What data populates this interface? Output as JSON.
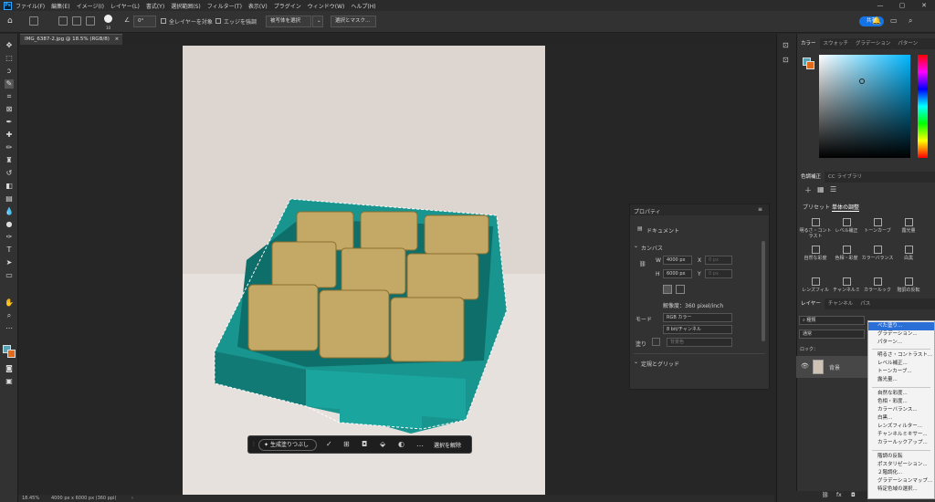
{
  "app": {
    "logo": "Ps"
  },
  "menu": [
    "ファイル(F)",
    "編集(E)",
    "イメージ(I)",
    "レイヤー(L)",
    "書式(Y)",
    "選択範囲(S)",
    "フィルター(T)",
    "表示(V)",
    "プラグイン",
    "ウィンドウ(W)",
    "ヘルプ(H)"
  ],
  "options": {
    "size": "10",
    "angle": "0°",
    "sample_all": "全レイヤーを対象",
    "enhance_edge": "エッジを強調",
    "select_subject": "被写体を選択",
    "select_mask": "選択とマスク...",
    "share": "共有"
  },
  "document_tab": {
    "label": "IMG_6387-2.jpg @ 18.5% (RGB/8)",
    "close": "×"
  },
  "status": {
    "zoom": "18.45%",
    "info": "4000 px x 6000 px (360 ppi)"
  },
  "taskbar": {
    "generative_fill": "生成塗りつぶし",
    "more": "…",
    "deselect": "選択を解除"
  },
  "color_panel": {
    "tabs": [
      "カラー",
      "スウォッチ",
      "グラデーション",
      "パターン"
    ],
    "accent": "#1473e6"
  },
  "adjust_panel": {
    "tabs": [
      "色調補正",
      "CC ライブラリ"
    ],
    "subtabs": [
      "プリセット",
      "単体の調整"
    ],
    "items": [
      "明るさ・コントラスト",
      "レベル補正",
      "トーンカーブ",
      "露光量",
      "自然な彩度",
      "色相・彩度",
      "カラーバランス",
      "白黒",
      "レンズフィル",
      "チャンネルミ",
      "カラールック",
      "階調の反転"
    ]
  },
  "layers_panel": {
    "tabs": [
      "レイヤー",
      "チャンネル",
      "パス"
    ],
    "search": "種類",
    "mode": "通常",
    "lock": "ロック：",
    "layer_name": "背景"
  },
  "properties": {
    "title": "プロパティ",
    "doc": "ドキュメント",
    "canvas": "カンバス",
    "w_label": "W",
    "w": "4000 px",
    "x_label": "X",
    "x": "0 px",
    "h_label": "H",
    "h": "6000 px",
    "y_label": "Y",
    "y": "0 px",
    "resolution": "解像度：360 pixel/inch",
    "mode_label": "モード",
    "mode": "RGB カラー",
    "bits": "8 bit/チャンネル",
    "fill_label": "塗り",
    "fill": "背景色",
    "guides": "定規とグリッド"
  },
  "dropdown": {
    "groups": [
      [
        "べた塗り...",
        "グラデーション...",
        "パターン..."
      ],
      [
        "明るさ・コントラスト...",
        "レベル補正...",
        "トーンカーブ...",
        "露光量..."
      ],
      [
        "自然な彩度...",
        "色相・彩度...",
        "カラーバランス...",
        "白黒...",
        "レンズフィルター...",
        "チャンネルミキサー...",
        "カラールックアップ..."
      ],
      [
        "階調の反転",
        "ポスタリゼーション...",
        "２階調化...",
        "グラデーションマップ...",
        "特定色域の選択..."
      ]
    ]
  }
}
